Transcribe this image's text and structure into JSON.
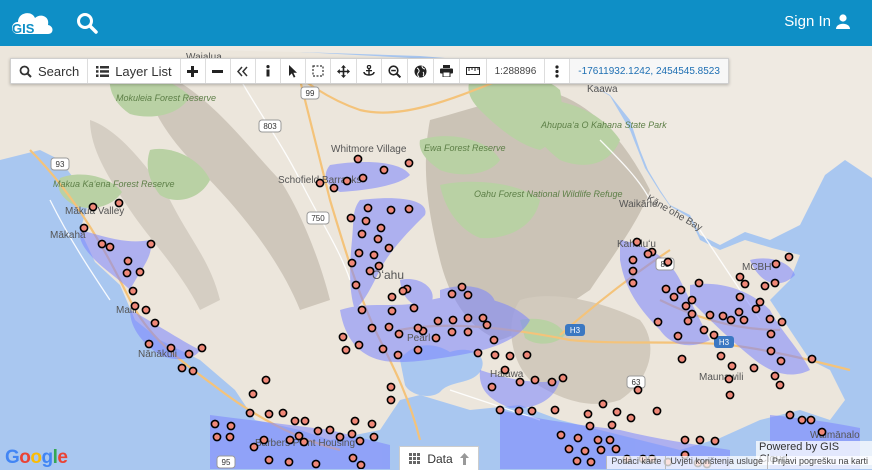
{
  "header": {
    "logo_text": "GIS",
    "sign_in_label": "Sign In"
  },
  "toolbar": {
    "search_label": "Search",
    "layer_list_label": "Layer List",
    "scale": "1:288896",
    "coordinates": "-17611932.1242, 2454545.8523"
  },
  "map_labels": {
    "waialua": "Waialua",
    "kaawa": "Kaawa",
    "mokuleia": "Mokuleia Forest Reserve",
    "ahupuaa": "Ahupuaʻa O Kahana State Park",
    "ewa_fr": "Ewa Forest Reserve",
    "makua_fr": "Makua Kaʻena Forest Reserve",
    "whitmore": "Whitmore Village",
    "schofield": "Schofield Barracks",
    "oahu_nwr": "Oahu Forest National Wildlife Refuge",
    "makua_valley": "Mākua Valley",
    "makaha": "Mākaha",
    "waikane": "Waikāne",
    "kaneohe_bay": "Kāneʻohe Bay",
    "kahaluu": "Kahaluʻu",
    "mcbh": "MCBH",
    "oahu": "Oʻahu",
    "maili": "Maili",
    "nanakuli": "Nānākuli",
    "pearl": "Pearl",
    "halawa": "Halawa",
    "maunawili": "Maunawili",
    "waimanalo": "Waimānalo",
    "barbers_point": "Barbers Point Housing",
    "shield_99": "99",
    "shield_803": "803",
    "shield_93": "93",
    "shield_750": "750",
    "shield_83": "83",
    "shield_63": "63",
    "shield_95": "95",
    "shield_h3": "H3",
    "shield_h3b": "H3"
  },
  "google_logo": "Google",
  "data_button_label": "Data",
  "powered_by": "Powered by GIS Cloud",
  "attribution": {
    "map_data": "Podaci karte",
    "terms": "Uvjeti korištenja usluge",
    "report": "Prijavi pogrešku na karti"
  },
  "colors": {
    "header": "#0e8fc6",
    "water": "#a9c7f0",
    "marker_fill": "#f08878",
    "marker_stroke": "#000000",
    "buffer": "#7b84ff"
  }
}
